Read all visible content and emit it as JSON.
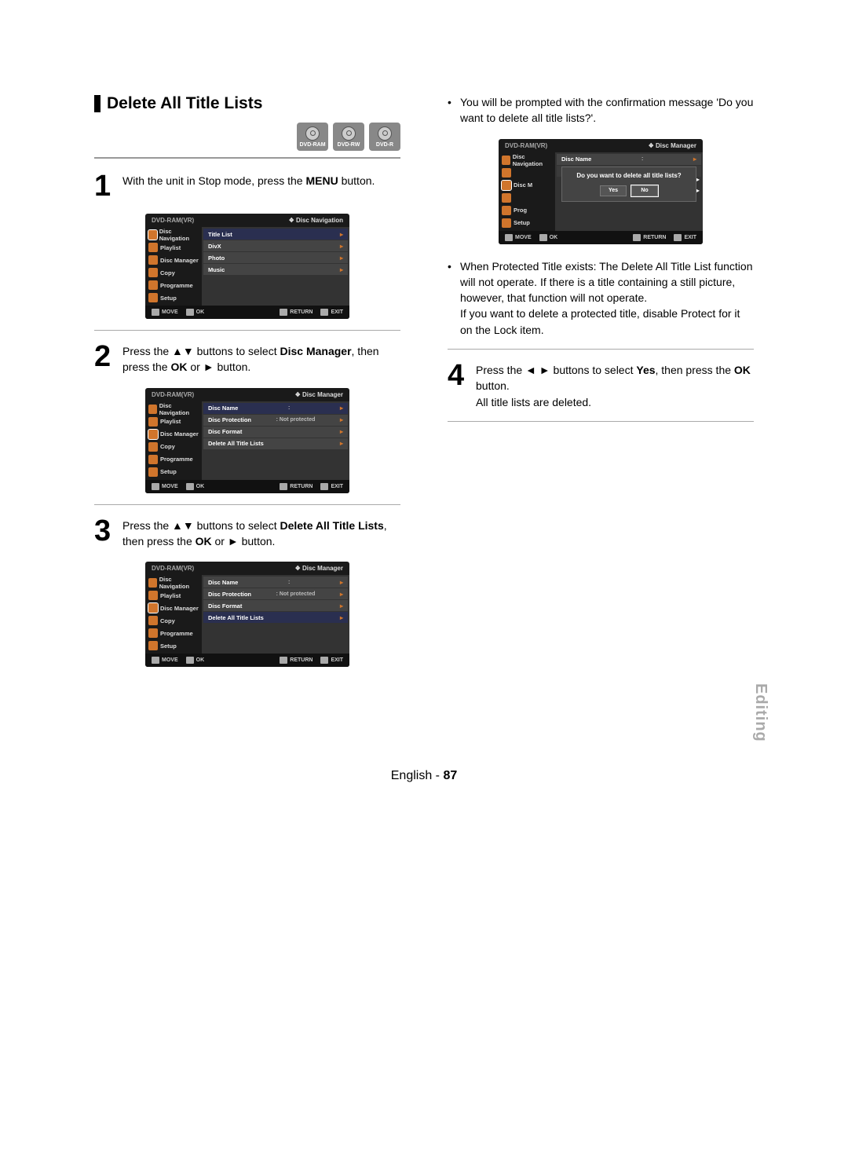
{
  "section_title": "Delete All Title Lists",
  "disc_types": [
    "DVD-RAM",
    "DVD-RW",
    "DVD-R"
  ],
  "steps": {
    "s1": {
      "num": "1",
      "pre": "With the unit in Stop mode, press the ",
      "b1": "MENU",
      "post": " button."
    },
    "s2": {
      "num": "2",
      "pre": "Press the ",
      "arrows": "▲▼",
      "mid": " buttons to select ",
      "b1": "Disc Manager",
      "after1": ", then press the ",
      "b2": "OK",
      "after2": " or ",
      "play": "►",
      "end": " button."
    },
    "s3": {
      "num": "3",
      "pre": "Press the ",
      "arrows": "▲▼",
      "mid": " buttons to select ",
      "b1": "Delete All Title Lists",
      "after1": ", then press the ",
      "b2": "OK",
      "after2": " or ",
      "play": "►",
      "end": " button."
    },
    "s4": {
      "num": "4",
      "pre": "Press the ",
      "arrows": "◄ ►",
      "mid": " buttons to select ",
      "b1": "Yes",
      "after1": ", then press the ",
      "b2": "OK",
      "end": " button.",
      "line2": "All title lists are deleted."
    }
  },
  "bullets": {
    "b1": "You will be prompted with the confirmation message 'Do you want to delete all title lists?'.",
    "b2a": "When Protected Title exists: The Delete All Title List function will not operate. If there is a title containing a still picture, however, that function will not operate.",
    "b2b": "If you want to delete a protected title, disable Protect for it on the Lock item."
  },
  "osd": {
    "mode": "DVD-RAM(VR)",
    "sidebar": [
      "Disc Navigation",
      "Playlist",
      "Disc Manager",
      "Copy",
      "Programme",
      "Setup"
    ],
    "nav_title": "Disc Navigation",
    "dm_title": "Disc Manager",
    "nav_items": [
      "Title List",
      "DivX",
      "Photo",
      "Music"
    ],
    "dm_items": [
      {
        "label": "Disc Name",
        "val": ":"
      },
      {
        "label": "Disc Protection",
        "val": ": Not protected"
      },
      {
        "label": "Disc Format",
        "val": ""
      },
      {
        "label": "Delete All Title Lists",
        "val": ""
      }
    ],
    "dialog": {
      "q": "Do you want to delete all title lists?",
      "yes": "Yes",
      "no": "No"
    },
    "footer": {
      "move": "MOVE",
      "ok": "OK",
      "return": "RETURN",
      "exit": "EXIT"
    }
  },
  "side_label": "Editing",
  "page_lang": "English",
  "page_num": "87"
}
